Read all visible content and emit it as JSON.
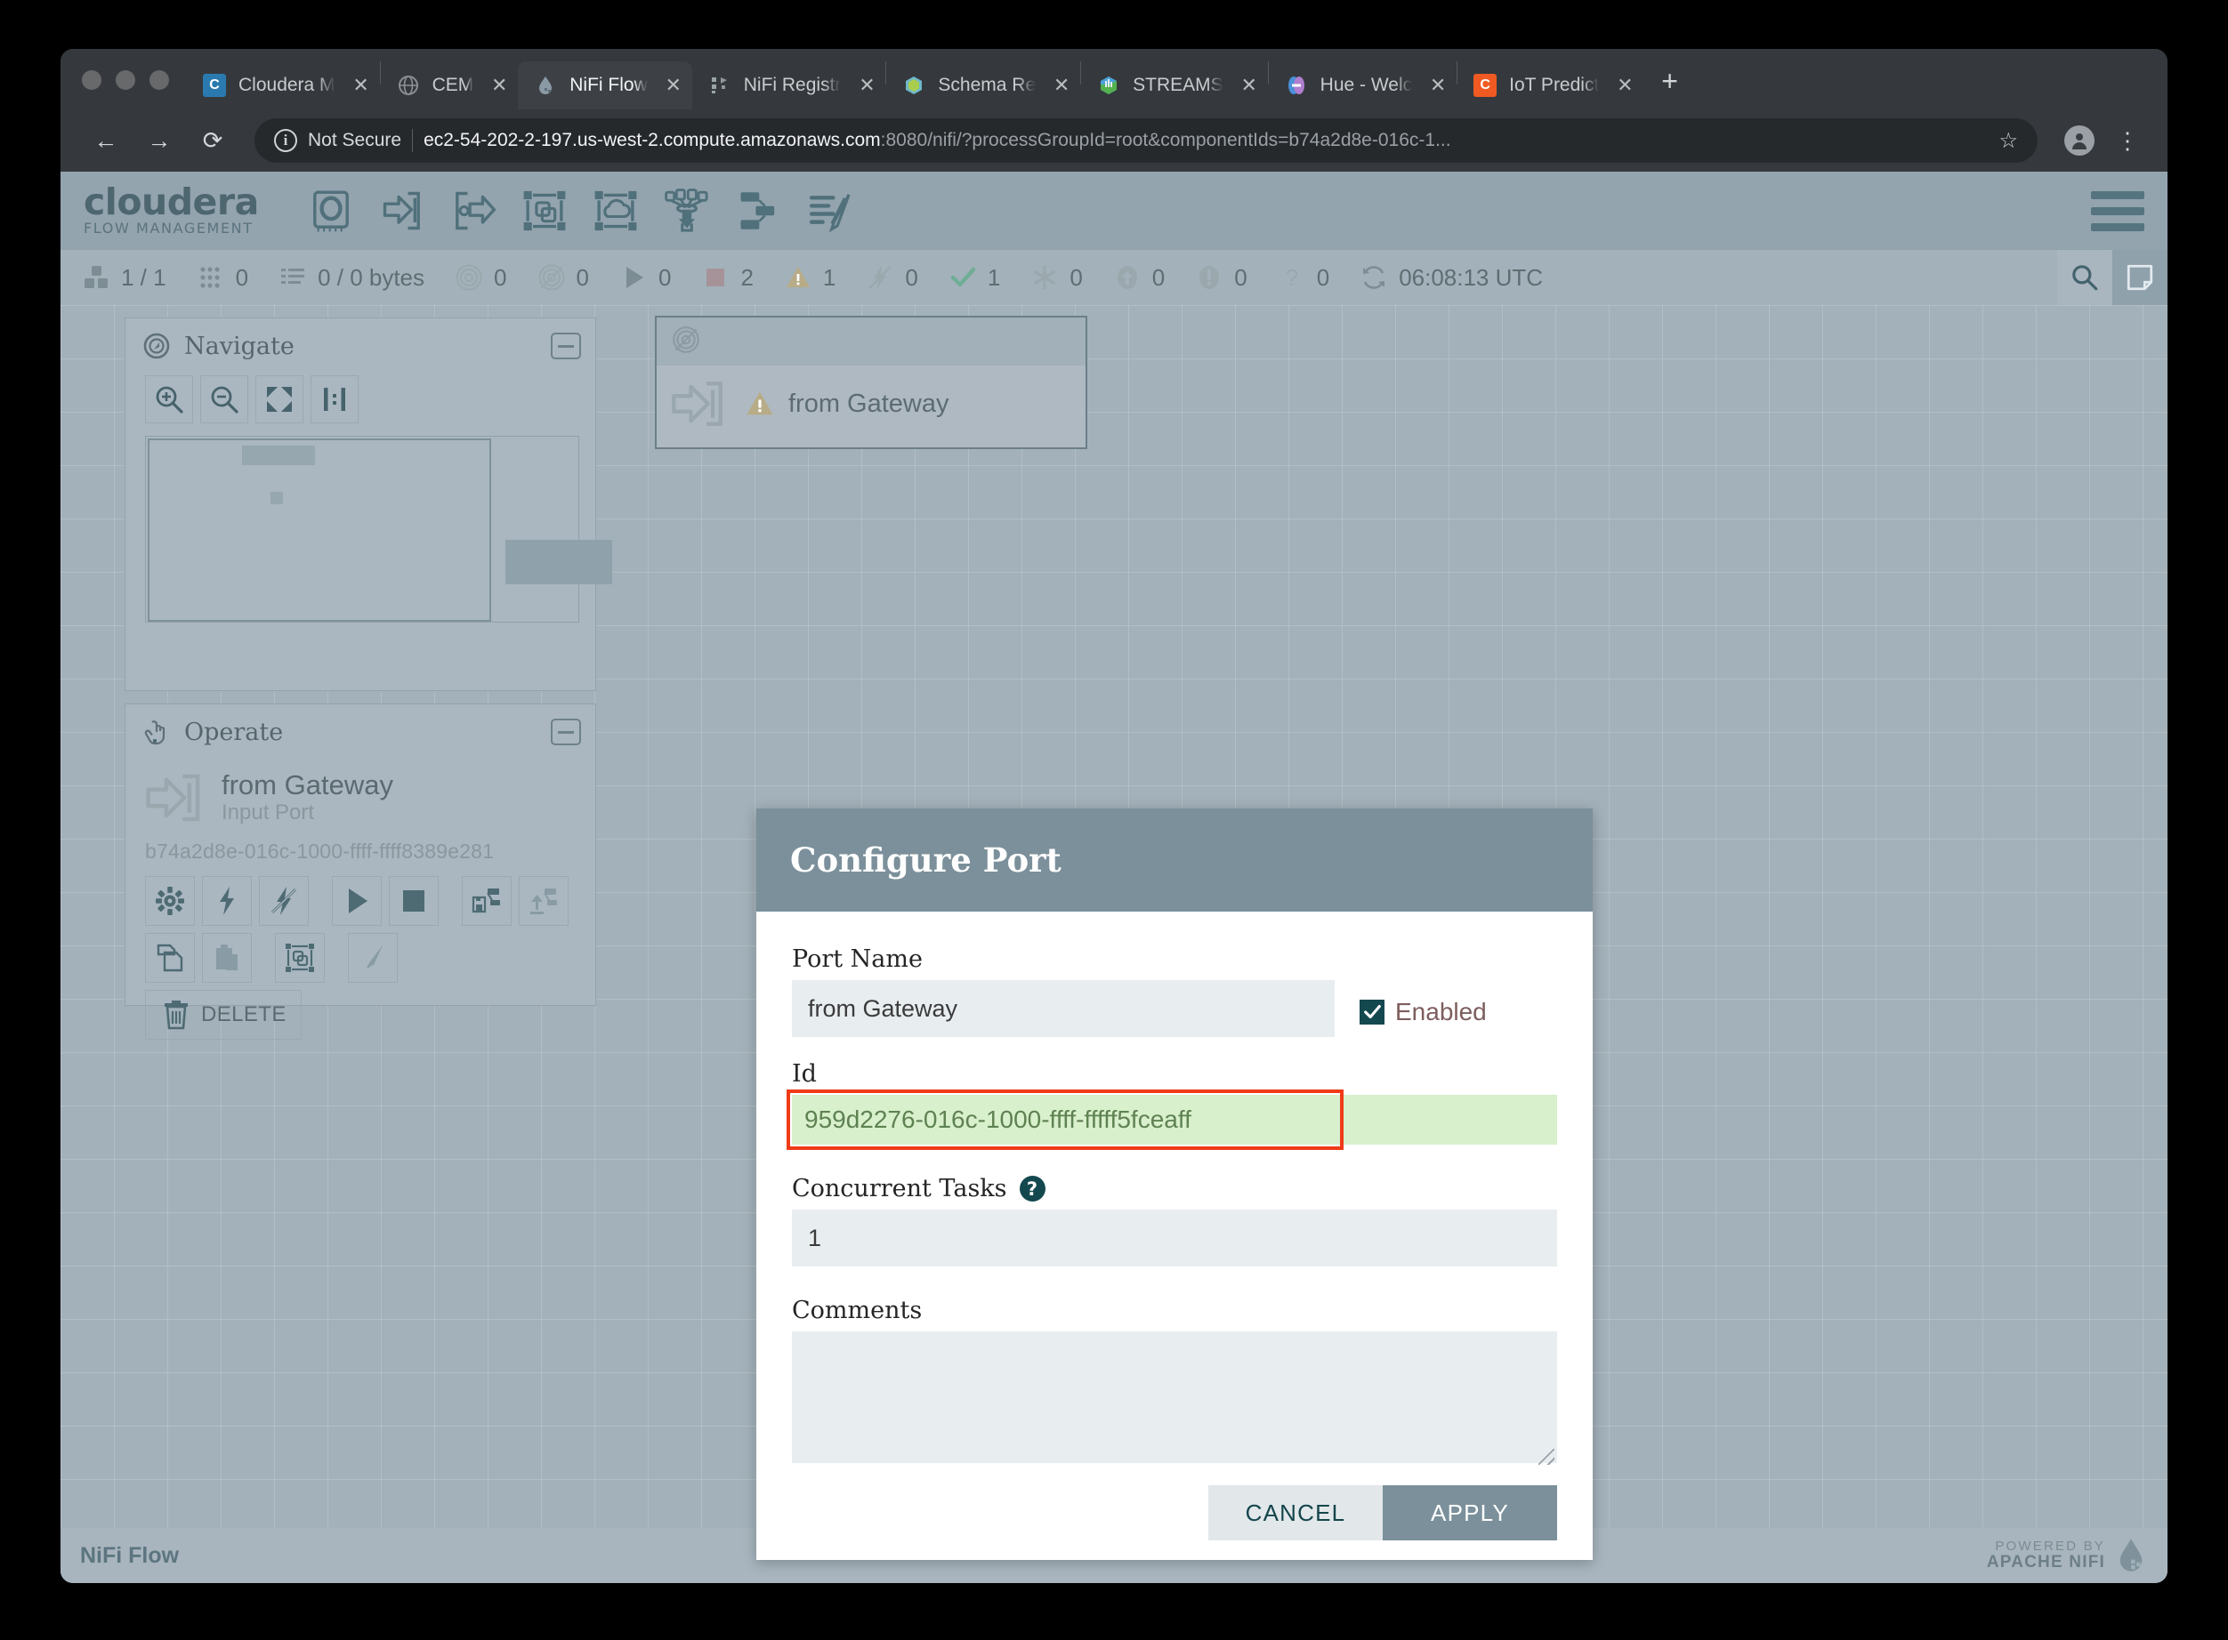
{
  "browser": {
    "tabs": [
      {
        "label": "Cloudera M",
        "favicon": "cloudera-icon",
        "active": false
      },
      {
        "label": "CEM",
        "favicon": "globe-icon",
        "active": false
      },
      {
        "label": "NiFi Flow",
        "favicon": "nifi-drop-icon",
        "active": true
      },
      {
        "label": "NiFi Registr",
        "favicon": "nifi-registry-icon",
        "active": false
      },
      {
        "label": "Schema Re",
        "favicon": "schema-registry-icon",
        "active": false
      },
      {
        "label": "STREAMS ",
        "favicon": "smm-icon",
        "active": false
      },
      {
        "label": "Hue - Welc",
        "favicon": "hue-icon",
        "active": false
      },
      {
        "label": "IoT Predict",
        "favicon": "cloudera-orange-icon",
        "active": false
      }
    ],
    "new_tab_label": "+",
    "close_label": "✕",
    "security_label": "Not Secure",
    "url_visible": "ec2-54-202-2-197.us-west-2.compute.amazonaws.com",
    "url_dim": ":8080/nifi/?processGroupId=root&componentIds=b74a2d8e-016c-1...",
    "back_label": "←",
    "forward_label": "→",
    "reload_label": "⟳",
    "star_label": "☆",
    "menu_label": "⋮"
  },
  "nifi": {
    "brand_line1": "cloudera",
    "brand_line2": "FLOW MANAGEMENT",
    "toolbar": [
      "processor-icon",
      "input-port-icon",
      "output-port-icon",
      "process-group-icon",
      "remote-process-group-icon",
      "funnel-icon",
      "template-icon",
      "label-icon"
    ],
    "status": [
      {
        "icon": "process-groups-icon",
        "value": "1 / 1"
      },
      {
        "icon": "threads-icon",
        "value": "0"
      },
      {
        "icon": "queued-icon",
        "value": "0 / 0 bytes"
      },
      {
        "icon": "transmitting-icon",
        "value": "0"
      },
      {
        "icon": "not-transmitting-icon",
        "value": "0"
      },
      {
        "icon": "running-icon",
        "value": "0"
      },
      {
        "icon": "stopped-icon",
        "value": "2"
      },
      {
        "icon": "invalid-icon",
        "value": "1"
      },
      {
        "icon": "disabled-icon",
        "value": "0"
      },
      {
        "icon": "up-to-date-icon",
        "value": "1"
      },
      {
        "icon": "locally-modified-icon",
        "value": "0"
      },
      {
        "icon": "stale-icon",
        "value": "0"
      },
      {
        "icon": "locally-modified-and-stale-icon",
        "value": "0"
      },
      {
        "icon": "sync-failure-icon",
        "value": "0"
      },
      {
        "icon": "refresh-icon",
        "value": "06:08:13 UTC"
      }
    ],
    "search_icon": "search-icon",
    "bulletin_icon": "bulletin-board-icon",
    "navigate": {
      "title": "Navigate",
      "icon": "compass-icon",
      "collapse_icon": "minimize-icon",
      "buttons": [
        "zoom-in-icon",
        "zoom-out-icon",
        "fit-to-screen-icon",
        "actual-size-icon"
      ]
    },
    "operate": {
      "title": "Operate",
      "icon": "hand-pointer-icon",
      "collapse_icon": "minimize-icon",
      "component_name": "from Gateway",
      "component_type": "Input Port",
      "component_id": "b74a2d8e-016c-1000-ffff-ffff8389e281",
      "buttons": [
        {
          "icon": "gear-icon",
          "label": ""
        },
        {
          "icon": "enable-icon",
          "label": ""
        },
        {
          "icon": "disable-icon",
          "label": ""
        },
        {
          "icon": "start-icon",
          "label": ""
        },
        {
          "icon": "stop-icon",
          "label": ""
        },
        {
          "icon": "version-save-icon",
          "label": ""
        },
        {
          "icon": "version-commit-icon",
          "label": ""
        },
        {
          "icon": "copy-icon",
          "label": ""
        },
        {
          "icon": "paste-icon",
          "label": ""
        },
        {
          "icon": "group-icon",
          "label": ""
        },
        {
          "icon": "color-icon",
          "label": ""
        },
        {
          "icon": "trash-icon",
          "label": "DELETE"
        }
      ]
    },
    "canvas_node": {
      "name": "from Gateway",
      "port_icon": "input-port-icon",
      "warning_icon": "warning-triangle-icon",
      "transmit_icon": "not-transmitting-icon"
    },
    "footer": {
      "flow_name": "NiFi Flow",
      "powered_line1": "POWERED BY",
      "powered_line2": "APACHE NIFI",
      "drop_icon": "nifi-drop-icon"
    }
  },
  "dialog": {
    "title": "Configure Port",
    "port_name_label": "Port Name",
    "port_name_value": "from Gateway",
    "enabled_label": "Enabled",
    "enabled_checked": true,
    "check_icon": "check-icon",
    "id_label": "Id",
    "id_value": "959d2276-016c-1000-ffff-fffff5fceaff",
    "concurrent_tasks_label": "Concurrent Tasks",
    "concurrent_tasks_help_icon": "help-icon",
    "concurrent_tasks_value": "1",
    "comments_label": "Comments",
    "comments_value": "",
    "comments_placeholder": "",
    "cancel_label": "CANCEL",
    "apply_label": "APPLY",
    "highlight_color": "#ef3b18",
    "id_background": "#d8f0cc",
    "accent_color": "#7b909b"
  }
}
